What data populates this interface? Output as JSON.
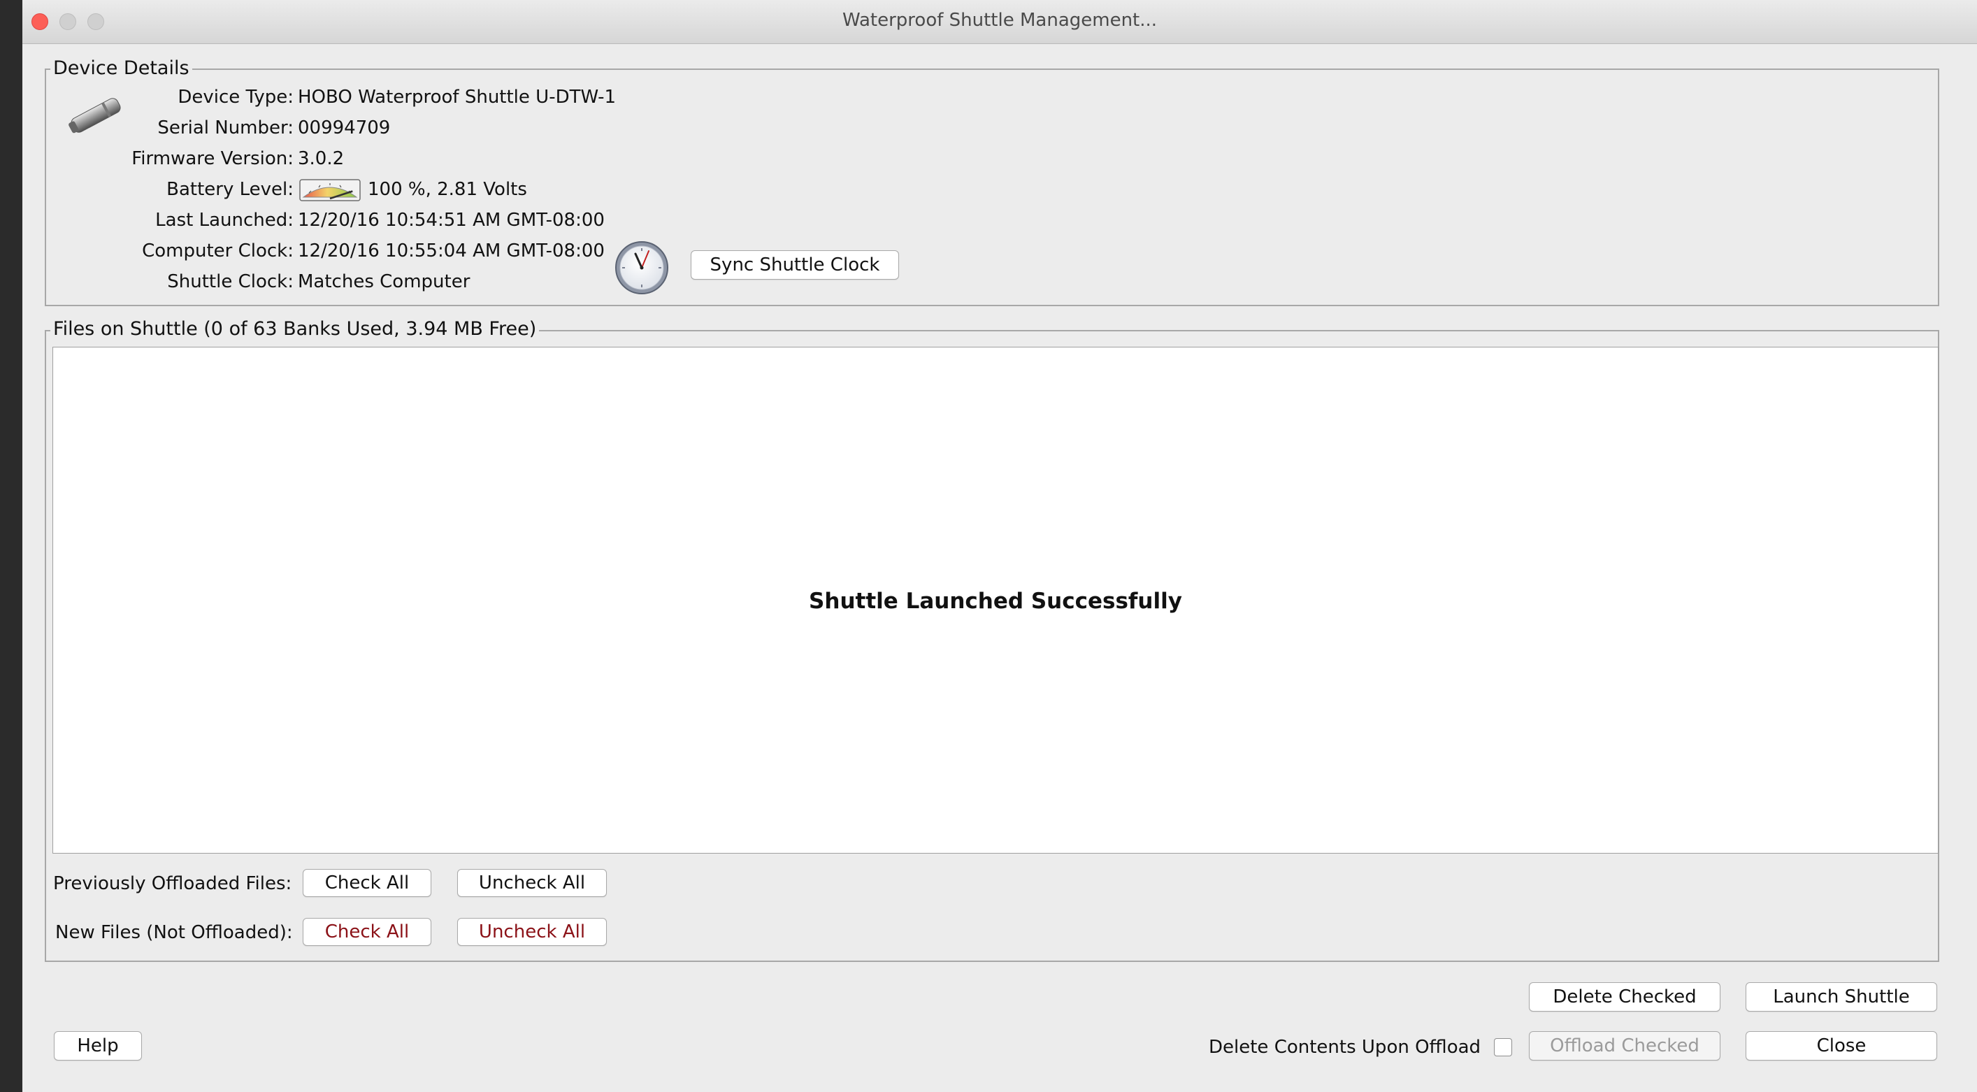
{
  "window": {
    "title": "Waterproof Shuttle Management..."
  },
  "device_details": {
    "legend": "Device Details",
    "rows": {
      "device_type": {
        "label": "Device Type:",
        "value": "HOBO Waterproof Shuttle U-DTW-1"
      },
      "serial_number": {
        "label": "Serial Number:",
        "value": "00994709"
      },
      "firmware_version": {
        "label": "Firmware Version:",
        "value": "3.0.2"
      },
      "battery_level": {
        "label": "Battery Level:",
        "value": "100 %, 2.81 Volts",
        "level": 1.0
      },
      "last_launched": {
        "label": "Last Launched:",
        "value": "12/20/16 10:54:51 AM GMT-08:00"
      },
      "computer_clock": {
        "label": "Computer Clock:",
        "value": "12/20/16 10:55:04 AM GMT-08:00"
      },
      "shuttle_clock": {
        "label": "Shuttle Clock:",
        "value": "Matches Computer"
      }
    },
    "sync_button": "Sync Shuttle Clock",
    "icons": {
      "device": "shuttle-device-icon",
      "clock": "clock-icon",
      "battery": "battery-gauge-icon"
    }
  },
  "files": {
    "legend": "Files on Shuttle (0 of 63 Banks Used, 3.94 MB Free)",
    "message": "Shuttle Launched Successfully",
    "previously_offloaded": {
      "label": "Previously Offloaded Files:",
      "check_all": "Check All",
      "uncheck_all": "Uncheck All"
    },
    "new_files": {
      "label": "New Files (Not Offloaded):",
      "check_all": "Check All",
      "uncheck_all": "Uncheck All"
    }
  },
  "footer": {
    "help": "Help",
    "delete_contents_label": "Delete Contents Upon Offload",
    "delete_contents_checked": false,
    "delete_checked": "Delete Checked",
    "launch_shuttle": "Launch Shuttle",
    "offload_checked": "Offload Checked",
    "close": "Close"
  },
  "colors": {
    "accent_red": "#8b1117",
    "traffic_close": "#fc5f57"
  }
}
